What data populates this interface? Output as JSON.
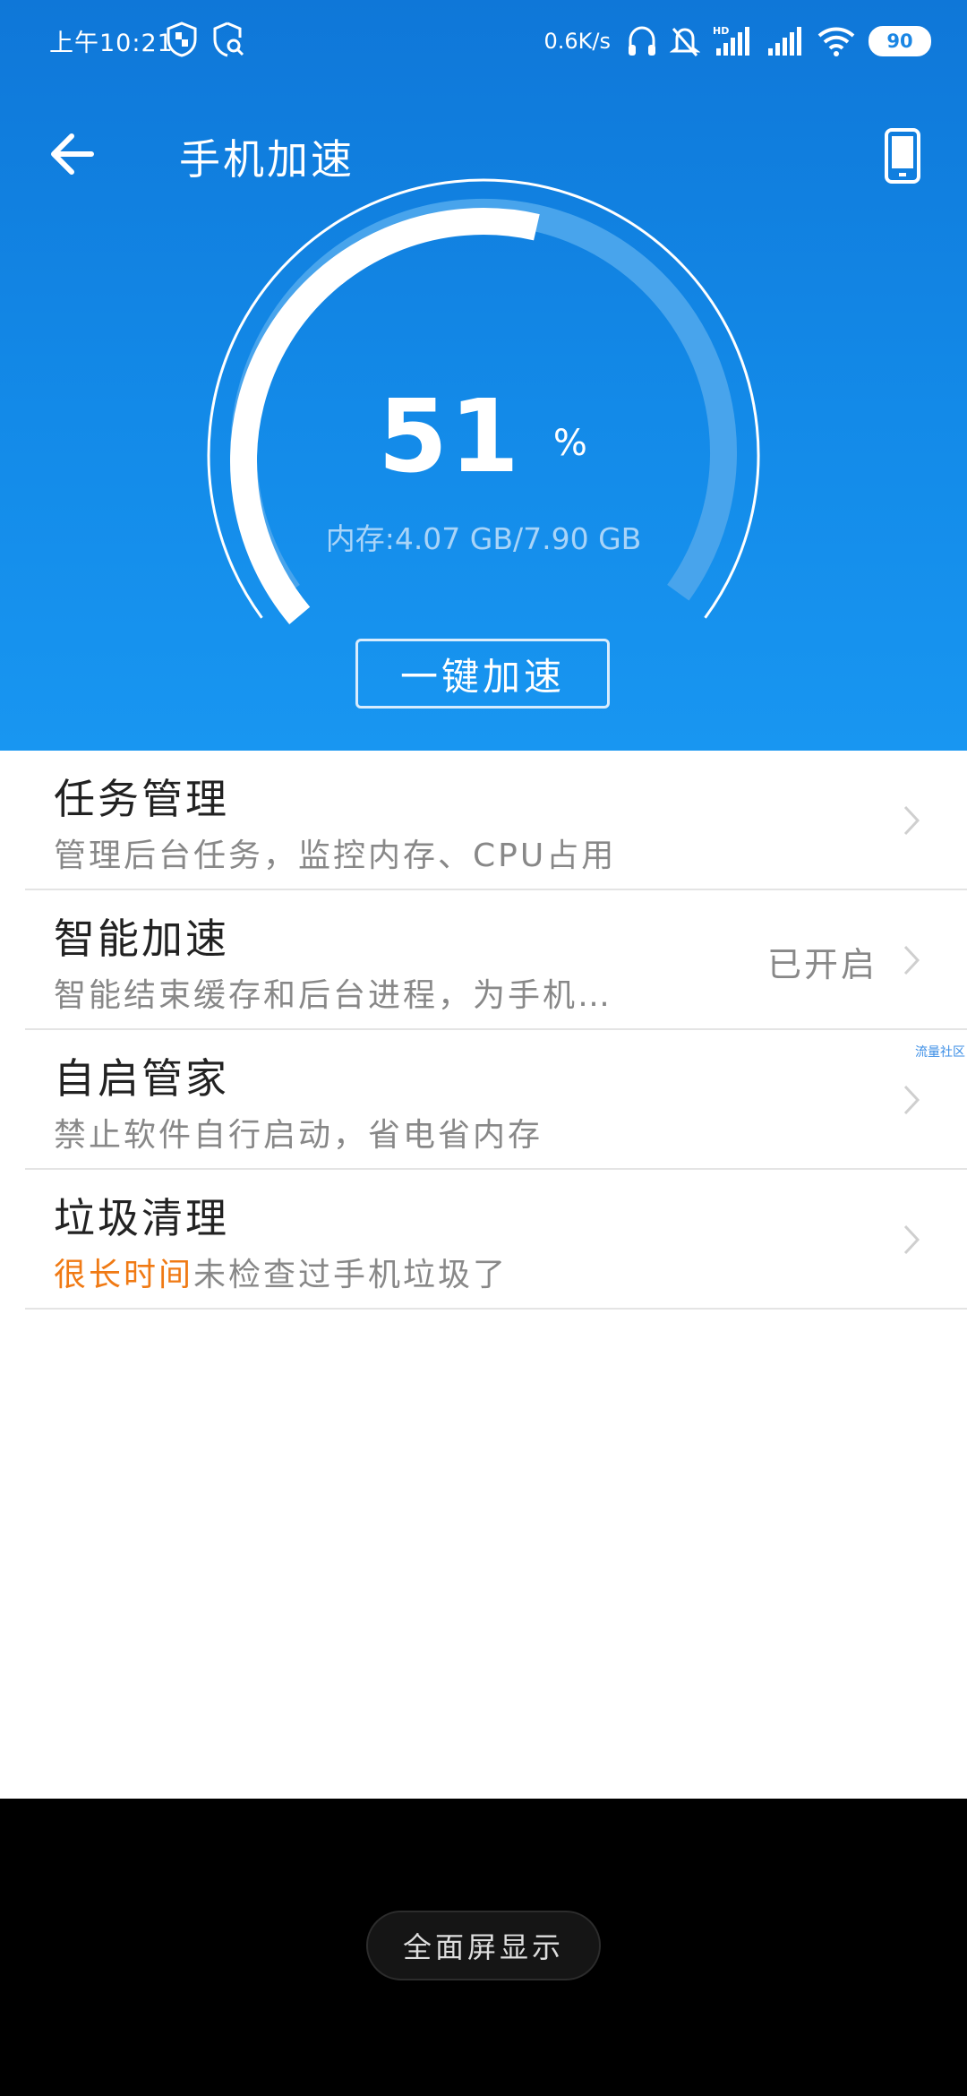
{
  "status_bar": {
    "time": "上午10:21",
    "net_speed": "0.6K/s",
    "battery": "90",
    "icons": [
      "shield-icon",
      "shield-search-icon",
      "headphones-icon",
      "bell-off-icon",
      "hd-signal-icon",
      "signal-icon",
      "wifi-icon"
    ]
  },
  "toolbar": {
    "title": "手机加速",
    "back_icon": "arrow-left-icon",
    "phone_icon": "phone-icon"
  },
  "gauge": {
    "percent": 51,
    "percent_text": "51",
    "unit": "%",
    "memory": "内存:4.07 GB/7.90 GB"
  },
  "boost_button": "一键加速",
  "items": [
    {
      "title": "任务管理",
      "subtitle": "管理后台任务，监控内存、CPU占用",
      "status": ""
    },
    {
      "title": "智能加速",
      "subtitle": "智能结束缓存和后台进程，为手机…",
      "status": "已开启"
    },
    {
      "title": "自启管家",
      "subtitle": "禁止软件自行启动，省电省内存",
      "status": ""
    },
    {
      "title": "垃圾清理",
      "subtitle_highlight": "很长时间",
      "subtitle_rest": "未检查过手机垃圾了",
      "status": ""
    }
  ],
  "watermark": "流量社区",
  "nav": {
    "fullscreen_label": "全面屏显示"
  },
  "colors": {
    "header_blue": "#138ae8",
    "warning_orange": "#f07a14"
  }
}
